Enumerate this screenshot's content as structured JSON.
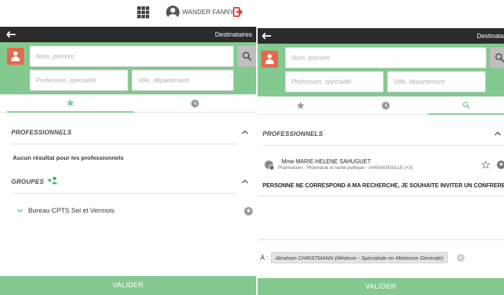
{
  "user": {
    "name": "WANDER FANNY",
    "icons": [
      "apps-grid-icon",
      "user-avatar-icon",
      "logout-icon"
    ]
  },
  "header": {
    "title": "Destinataires"
  },
  "search": {
    "name_placeholder": "Nom, prénom",
    "profession_placeholder": "Profession, spécialité",
    "city_placeholder": "Ville, département"
  },
  "tabs": {
    "favorites_icon": "star-icon",
    "recent_icon": "clock-icon",
    "search_icon": "search-icon"
  },
  "left": {
    "professionals_title": "PROFESSIONNELS",
    "no_result": "Aucun résultat pour les professionnels",
    "groups_title": "GROUPES",
    "group_item": "Bureau CPTS Sel et Vermois",
    "validate": "VALIDER"
  },
  "right": {
    "professionals_title": "PROFESSIONNELS",
    "result": {
      "name": "Mme MARIE-HELENE SAHUGUET",
      "details": "Pharmacien - Pharmacie et santé publique - VARANGEVILLE (+3)"
    },
    "invite": "PERSONNE NE CORRESPOND A MA RECHERCHE, JE SOUHAITE INVITER UN CONFRERE",
    "to_label": "À :",
    "recipient": "Abraham CHRISTMANN (Médecin - Spécialiste en Médecine Générale)",
    "validate": "VALIDER"
  },
  "colors": {
    "green": "#84c98f",
    "dark": "#2b2b2b",
    "orange": "#e46a4b",
    "logout_red": "#e0463c"
  }
}
